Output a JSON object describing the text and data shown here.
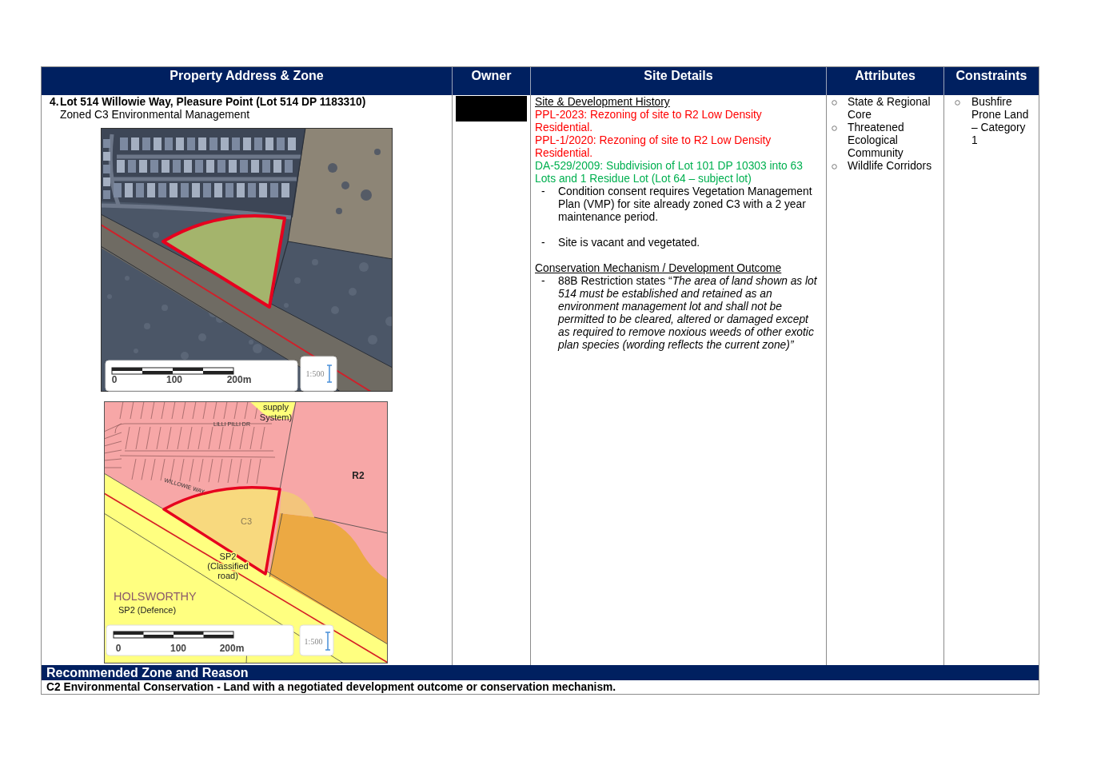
{
  "header": {
    "columns": [
      "Property Address & Zone",
      "Owner",
      "Site Details",
      "Attributes",
      "Constraints"
    ]
  },
  "property": {
    "number": "4.",
    "address": "Lot 514 Willowie Way, Pleasure Point (Lot 514 DP 1183310)",
    "zone": "Zoned C3 Environmental Management",
    "aerial_map": {
      "scale_labels": [
        "0",
        "100",
        "200m"
      ],
      "scale_ratio": "1:500"
    },
    "zoning_map": {
      "labels": [
        {
          "kind": "street",
          "lines": [
            "LILLI PILLI DR"
          ]
        },
        {
          "kind": "zone",
          "lines": [
            "supply",
            "System)"
          ]
        },
        {
          "kind": "zone",
          "lines": [
            "R2"
          ]
        },
        {
          "kind": "street",
          "lines": [
            "WILLOWIE WAY"
          ]
        },
        {
          "kind": "zone",
          "lines": [
            "C3"
          ]
        },
        {
          "kind": "zone",
          "lines": [
            "SP2",
            "(Classified",
            "road)"
          ]
        },
        {
          "kind": "locality",
          "lines": [
            "HOLSWORTHY"
          ]
        },
        {
          "kind": "zone",
          "lines": [
            "SP2 (Defence)"
          ]
        }
      ],
      "scale_labels": [
        "0",
        "100",
        "200m"
      ],
      "scale_ratio": "1:500"
    }
  },
  "owner": {
    "redacted": true
  },
  "site_details": {
    "sections": [
      {
        "heading": "Site & Development History",
        "items": [
          {
            "kind": "entry",
            "text": "PPL-2023: Rezoning of site to R2 Low Density Residential.",
            "color": "#ff0000"
          },
          {
            "kind": "entry",
            "text": "PPL-1/2020: Rezoning of site to R2 Low Density Residential.",
            "color": "#ff0000"
          },
          {
            "kind": "entry",
            "text": "DA-529/2009: Subdivision of Lot 101 DP 10303 into 63 Lots and 1 Residue Lot (Lot 64 – subject lot)",
            "color": "#00b050"
          },
          {
            "kind": "bullet",
            "marker": "-",
            "text": "Condition consent requires Vegetation Management Plan (VMP) for site already zoned C3 with a 2 year maintenance period."
          },
          {
            "kind": "bullet",
            "marker": "-",
            "text": "Site is vacant and vegetated."
          }
        ]
      },
      {
        "heading": "Conservation Mechanism / Development Outcome",
        "items": [
          {
            "kind": "bullet",
            "marker": "-",
            "text": "88B Restriction states “*The area of land shown as lot 514 must be established and retained as an environment management lot and shall not be permitted to be cleared, altered or damaged except as required to remove noxious weeds of other exotic plan species (wording reflects the current zone)”*"
          }
        ]
      }
    ]
  },
  "attributes": [
    "State & Regional Core",
    "Threatened Ecological Community",
    "Wildlife Corridors"
  ],
  "constraints": [
    "Bushfire Prone Land – Category 1"
  ],
  "recommendation": {
    "heading": "Recommended Zone and Reason",
    "text": "C2 Environmental Conservation - Land with a negotiated development outcome or conservation mechanism."
  }
}
